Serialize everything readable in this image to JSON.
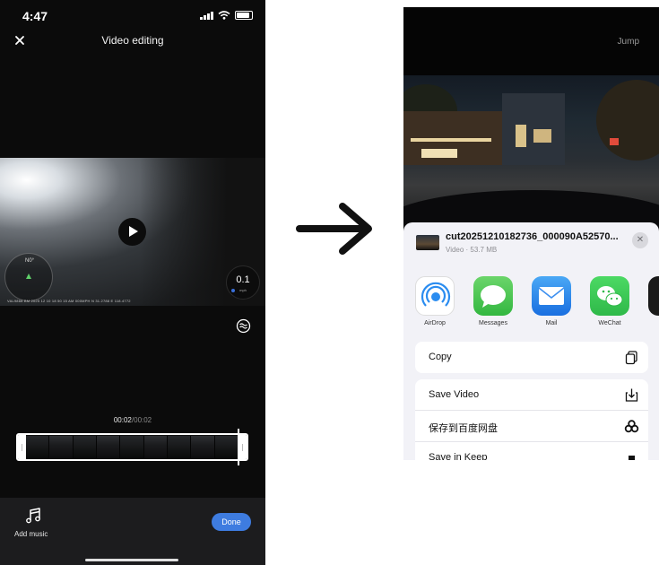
{
  "left_screen": {
    "status_time": "4:47",
    "nav_title": "Video editing",
    "overlay": {
      "compass_label": "N0°",
      "strip_text": "VAL9868 BM 2025 12 10 18 50 15 AM 000MPH N 31.2788 E 118.4772",
      "speed_value": "0.1",
      "speed_unit": "mph"
    },
    "timecode_current": "00:02",
    "timecode_total": "/00:02",
    "add_music_label": "Add music",
    "done_label": "Done",
    "accent_color": "#3e7ce0"
  },
  "right_screen": {
    "jump_label": "Jump",
    "share": {
      "file_name": "cut20251210182736_000090A52570...",
      "file_meta": "Video · 53.7 MB",
      "apps": [
        {
          "label": "AirDrop",
          "icon": "airdrop-icon"
        },
        {
          "label": "Messages",
          "icon": "messages-icon"
        },
        {
          "label": "Mail",
          "icon": "mail-icon"
        },
        {
          "label": "WeChat",
          "icon": "wechat-icon"
        }
      ],
      "actions_group1": [
        {
          "label": "Copy",
          "icon": "copy-icon"
        }
      ],
      "actions_group2": [
        {
          "label": "Save Video",
          "icon": "save-video-icon"
        },
        {
          "label": "保存到百度网盘",
          "icon": "baidu-netdisk-icon"
        },
        {
          "label": "Save in Keep",
          "icon": "keep-icon"
        }
      ]
    }
  }
}
